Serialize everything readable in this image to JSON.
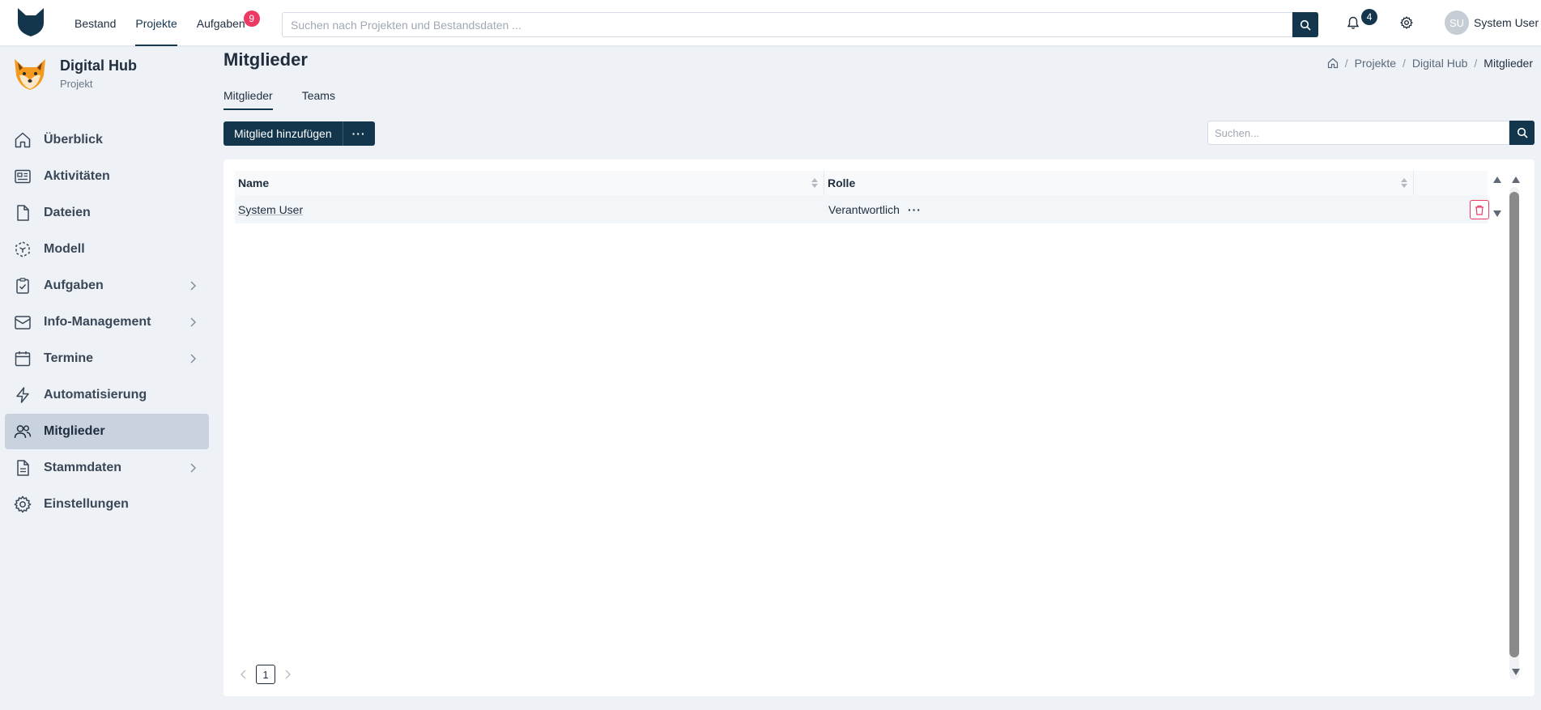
{
  "topnav": {
    "items": [
      {
        "label": "Bestand",
        "active": false
      },
      {
        "label": "Projekte",
        "active": true
      },
      {
        "label": "Aufgaben",
        "active": false,
        "badge": "9"
      }
    ],
    "search_placeholder": "Suchen nach Projekten und Bestandsdaten ...",
    "notifications_count": "4",
    "user": {
      "initials": "SU",
      "name": "System User"
    }
  },
  "project": {
    "name": "Digital Hub",
    "type": "Projekt"
  },
  "sidebar": {
    "items": [
      {
        "label": "Überblick",
        "icon": "home-icon",
        "chevron": false,
        "active": false
      },
      {
        "label": "Aktivitäten",
        "icon": "newspaper-icon",
        "chevron": false,
        "active": false
      },
      {
        "label": "Dateien",
        "icon": "file-icon",
        "chevron": false,
        "active": false
      },
      {
        "label": "Modell",
        "icon": "cube-icon",
        "chevron": false,
        "active": false
      },
      {
        "label": "Aufgaben",
        "icon": "clipboard-check-icon",
        "chevron": true,
        "active": false
      },
      {
        "label": "Info-Management",
        "icon": "inbox-icon",
        "chevron": true,
        "active": false
      },
      {
        "label": "Termine",
        "icon": "calendar-icon",
        "chevron": true,
        "active": false
      },
      {
        "label": "Automatisierung",
        "icon": "lightning-icon",
        "chevron": false,
        "active": false
      },
      {
        "label": "Mitglieder",
        "icon": "users-icon",
        "chevron": false,
        "active": true
      },
      {
        "label": "Stammdaten",
        "icon": "document-icon",
        "chevron": true,
        "active": false
      },
      {
        "label": "Einstellungen",
        "icon": "gear-icon",
        "chevron": false,
        "active": false
      }
    ]
  },
  "page": {
    "title": "Mitglieder",
    "breadcrumb": [
      "Projekte",
      "Digital Hub",
      "Mitglieder"
    ],
    "tabs": [
      {
        "label": "Mitglieder",
        "active": true
      },
      {
        "label": "Teams",
        "active": false
      }
    ],
    "add_button": "Mitglied hinzufügen",
    "more_button": "···",
    "search_placeholder": "Suchen..."
  },
  "table": {
    "columns": [
      "Name",
      "Rolle"
    ],
    "rows": [
      {
        "name": "System User",
        "role": "Verantwortlich",
        "role_more": "···"
      }
    ]
  },
  "pagination": {
    "current": "1"
  },
  "colors": {
    "primary": "#13364d",
    "accent": "#ec3a63",
    "background": "#eef2f7",
    "active_menu": "#c9d3df"
  }
}
